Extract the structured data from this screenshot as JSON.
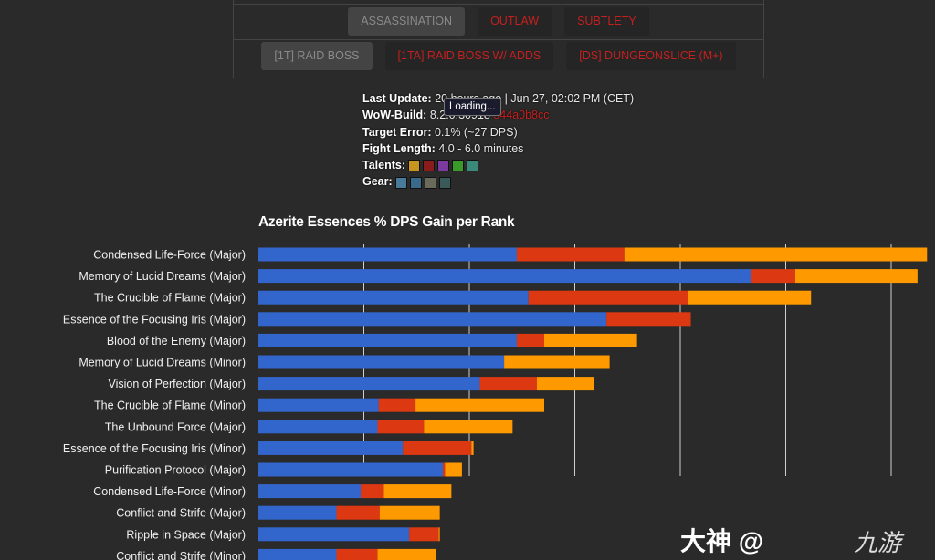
{
  "spec_tabs": [
    {
      "label": "ASSASSINATION",
      "active": true
    },
    {
      "label": "OUTLAW",
      "active": false
    },
    {
      "label": "SUBTLETY",
      "active": false
    }
  ],
  "fight_tabs": [
    {
      "label": "[1T] RAID BOSS",
      "active": true
    },
    {
      "label": "[1TA] RAID BOSS W/ ADDS",
      "active": false
    },
    {
      "label": "[DS] DUNGEONSLICE (M+)",
      "active": false
    }
  ],
  "info": {
    "last_update_label": "Last Update:",
    "last_update_value": "20 hours ago | Jun 27, 02:02 PM (CET)",
    "build_label": "WoW-Build:",
    "build_value": "8.2.0.30918",
    "build_hash": "544a0b8cc",
    "target_error_label": "Target Error:",
    "target_error_value": "0.1% (~27 DPS)",
    "fight_length_label": "Fight Length:",
    "fight_length_value": "4.0 - 6.0 minutes",
    "talents_label": "Talents:",
    "gear_label": "Gear:",
    "talent_icon_colors": [
      "#c8961e",
      "#8a1c1c",
      "#7a3aa0",
      "#3a9a2a",
      "#3a8a7a"
    ],
    "gear_icon_colors": [
      "#4a7a9a",
      "#3a6a8a",
      "#6a6a5a",
      "#3a5a5a"
    ]
  },
  "loading_tooltip": "Loading...",
  "chart_data": {
    "type": "bar",
    "stacked": true,
    "orientation": "horizontal",
    "title": "Azerite Essences % DPS Gain per Rank",
    "grid": true,
    "xlim": [
      0,
      6.35
    ],
    "categories": [
      "Condensed Life-Force (Major)",
      "Memory of Lucid Dreams (Major)",
      "The Crucible of Flame (Major)",
      "Essence of the Focusing Iris (Major)",
      "Blood of the Enemy (Major)",
      "Memory of Lucid Dreams (Minor)",
      "Vision of Perfection (Major)",
      "The Crucible of Flame (Minor)",
      "The Unbound Force (Major)",
      "Essence of the Focusing Iris (Minor)",
      "Purification Protocol (Major)",
      "Condensed Life-Force (Minor)",
      "Conflict and Strife (Major)",
      "Ripple in Space (Major)",
      "Conflict and Strife (Minor)"
    ],
    "series": [
      {
        "color": "#3366cc",
        "values": [
          2.45,
          4.67,
          2.56,
          3.3,
          2.45,
          2.33,
          2.1,
          1.14,
          1.13,
          1.37,
          1.75,
          0.97,
          0.74,
          1.43,
          0.74
        ]
      },
      {
        "color": "#dc3912",
        "values": [
          1.02,
          0.42,
          1.51,
          0.8,
          0.26,
          0,
          0.54,
          0.35,
          0.44,
          0.65,
          0.02,
          0.22,
          0.41,
          0.28,
          0.39
        ]
      },
      {
        "color": "#ff9900",
        "values": [
          2.87,
          1.16,
          1.17,
          0,
          0.88,
          1.0,
          0.54,
          1.22,
          0.84,
          0.02,
          0.16,
          0.64,
          0.57,
          0.01,
          0.55
        ]
      }
    ]
  },
  "watermark": {
    "text": "大神 @",
    "logo": "九游"
  }
}
